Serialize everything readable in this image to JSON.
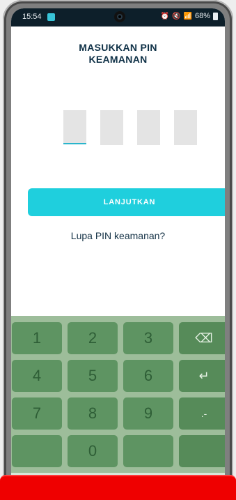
{
  "status_bar": {
    "time": "15:54",
    "battery_percent": "68%",
    "icons": [
      "alarm-icon",
      "mute-icon",
      "wifi-icon",
      "signal-icon",
      "battery-icon"
    ]
  },
  "screen": {
    "title_line1": "MASUKKAN PIN",
    "title_line2": "KEAMANAN",
    "pin_length": 4,
    "continue_label": "LANJUTKAN",
    "forgot_label": "Lupa PIN keamanan?"
  },
  "keypad": {
    "keys": [
      "1",
      "2",
      "3",
      "4",
      "5",
      "6",
      "7",
      "8",
      "9",
      "0"
    ],
    "backspace_symbol": "⌫",
    "enter_symbol": "↵",
    "dot_dash_symbol": ".-"
  },
  "nav": {
    "recents": "|||",
    "home": "○",
    "back": "﹀"
  },
  "colors": {
    "accent": "#1fcfdd",
    "title": "#0f3147",
    "keypad_bg": "#9dbd9a",
    "key": "#5e9462",
    "banner": "#ef0000"
  }
}
